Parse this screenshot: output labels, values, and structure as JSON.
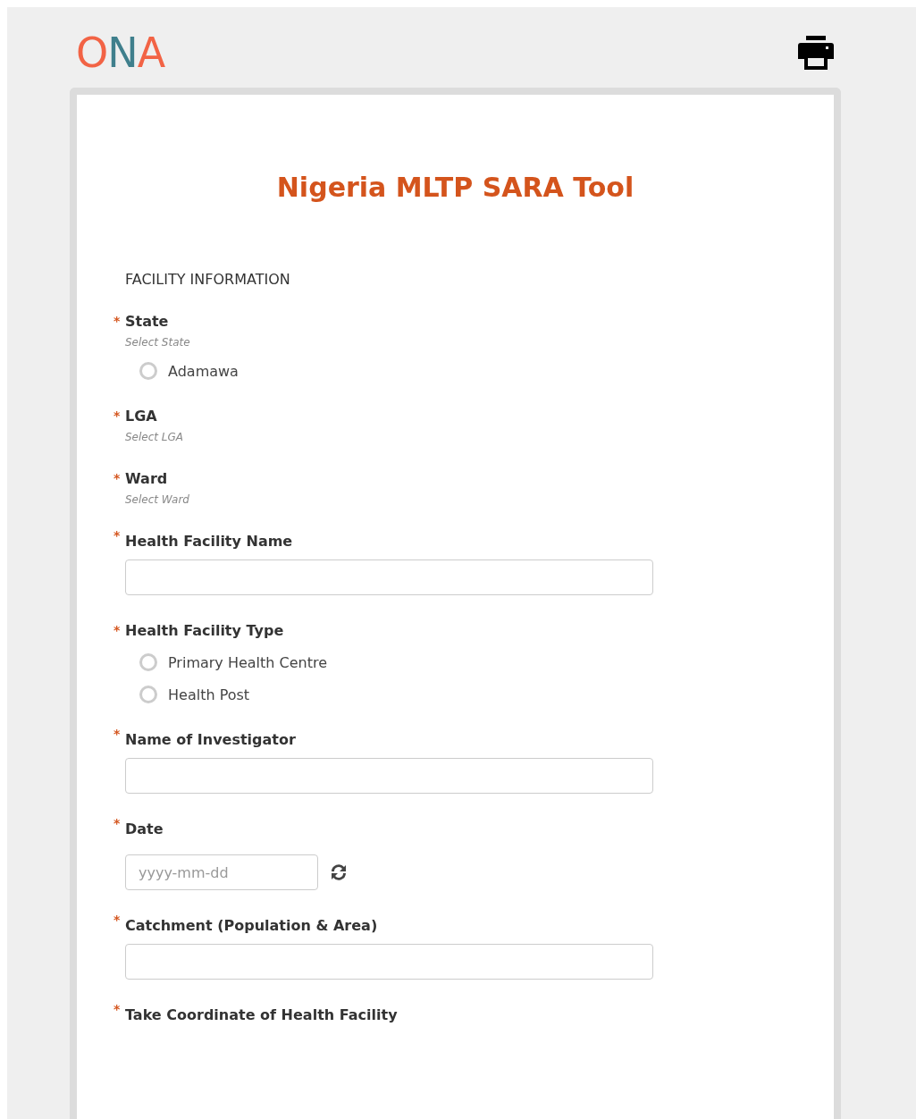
{
  "header": {
    "logo": "ONA"
  },
  "form": {
    "title": "Nigeria MLTP SARA Tool",
    "section": "FACILITY INFORMATION",
    "questions": [
      {
        "kind": "select",
        "label": "State",
        "required_mark": "*",
        "hint": "Select State",
        "options": [
          {
            "label": "Adamawa",
            "selected": false
          }
        ]
      },
      {
        "kind": "select",
        "label": "LGA",
        "required_mark": "*",
        "hint": "Select LGA"
      },
      {
        "kind": "select",
        "label": "Ward",
        "required_mark": "*",
        "hint": "Select Ward"
      },
      {
        "kind": "text",
        "label": "Health Facility Name",
        "required_mark": "*"
      },
      {
        "kind": "select",
        "label": "Health Facility Type",
        "required_mark": "*",
        "options": [
          {
            "label": "Primary Health Centre",
            "selected": false
          },
          {
            "label": "Health Post",
            "selected": false
          }
        ]
      },
      {
        "kind": "text",
        "label": "Name of Investigator",
        "required_mark": "*"
      },
      {
        "kind": "date",
        "label": "Date",
        "required_mark": "*",
        "placeholder": "yyyy-mm-dd"
      },
      {
        "kind": "text",
        "label": "Catchment (Population & Area)",
        "required_mark": "*"
      },
      {
        "kind": "geo",
        "label": "Take Coordinate of Health Facility",
        "required_mark": "*"
      }
    ]
  }
}
